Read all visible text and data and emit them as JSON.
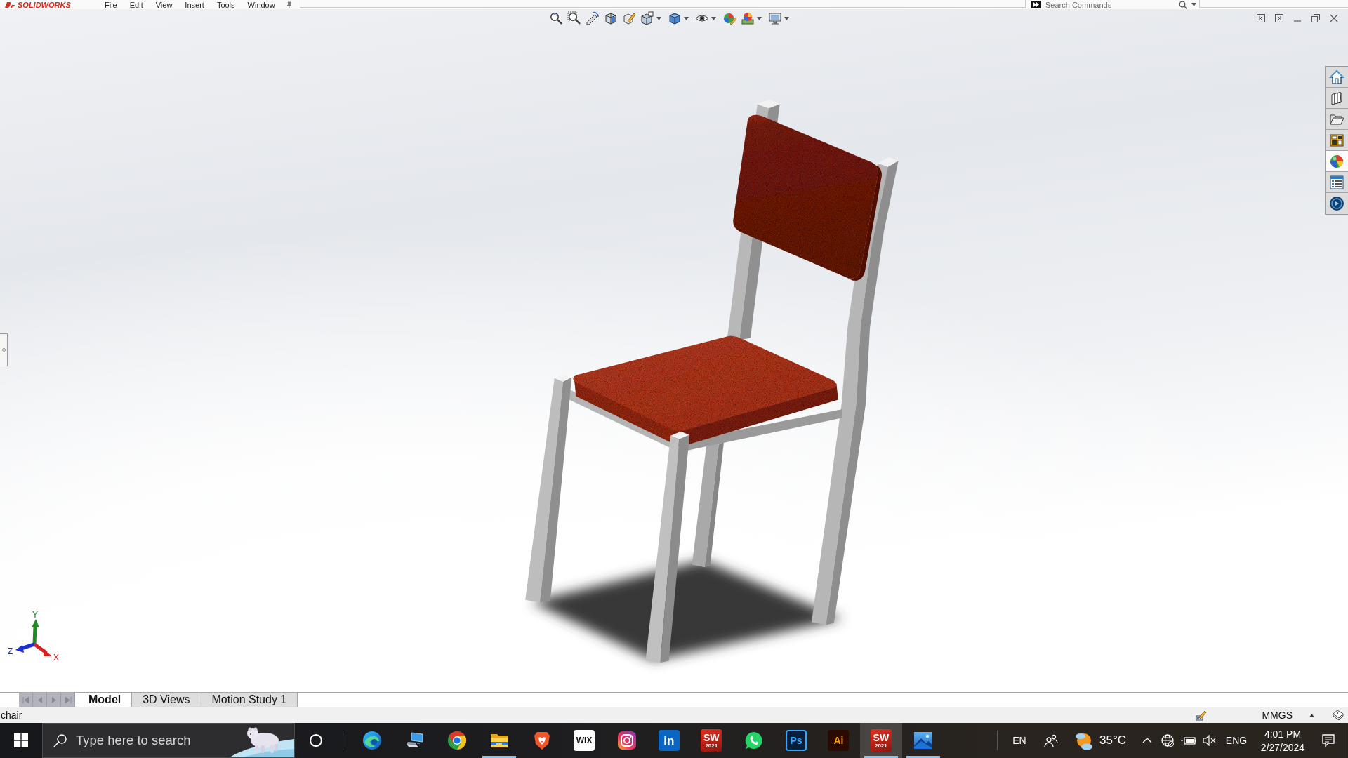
{
  "app": {
    "logo": "SOLIDWORKS",
    "menu": [
      "File",
      "Edit",
      "View",
      "Insert",
      "Tools",
      "Window"
    ],
    "search": {
      "placeholder": "Search Commands"
    }
  },
  "task_pane": {
    "tabs": [
      {
        "kind": "home",
        "selected": false
      },
      {
        "kind": "library",
        "selected": false
      },
      {
        "kind": "folder",
        "selected": false
      },
      {
        "kind": "palette",
        "selected": false
      },
      {
        "kind": "appearance",
        "selected": true
      },
      {
        "kind": "properties",
        "selected": false
      },
      {
        "kind": "forum",
        "selected": false
      }
    ]
  },
  "triad": {
    "axes": [
      {
        "label": "Y",
        "color": "#1e8c1e"
      },
      {
        "label": "Z",
        "color": "#1c2fd6"
      },
      {
        "label": "X",
        "color": "#d42020"
      }
    ]
  },
  "document_tabs": [
    {
      "label": "Model",
      "selected": true
    },
    {
      "label": "3D Views",
      "selected": false
    },
    {
      "label": "Motion Study 1",
      "selected": false
    }
  ],
  "status_bar": {
    "document": "chair",
    "units": "MMGS"
  },
  "taskbar": {
    "search": {
      "placeholder": "Type here to search"
    },
    "apps": [
      {
        "kind": "edge",
        "open": false,
        "selected": false
      },
      {
        "kind": "computer",
        "open": false,
        "selected": false
      },
      {
        "kind": "chrome",
        "open": false,
        "selected": false
      },
      {
        "kind": "explorer",
        "open": true,
        "selected": false
      },
      {
        "kind": "brave",
        "open": false,
        "selected": false
      },
      {
        "kind": "wix",
        "label": "WIX",
        "open": false,
        "selected": false
      },
      {
        "kind": "instagram",
        "open": false,
        "selected": false
      },
      {
        "kind": "linkedin",
        "label": "in",
        "open": false,
        "selected": false
      },
      {
        "kind": "solidworks",
        "label": "SW",
        "sublabel": "2021",
        "open": false,
        "selected": false
      },
      {
        "kind": "whatsapp",
        "open": false,
        "selected": false
      },
      {
        "kind": "photoshop",
        "label": "Ps",
        "open": false,
        "selected": false
      },
      {
        "kind": "illustrator",
        "label": "Ai",
        "open": false,
        "selected": false
      },
      {
        "kind": "solidworks",
        "label": "SW",
        "sublabel": "2021",
        "open": true,
        "selected": true
      },
      {
        "kind": "photos",
        "open": true,
        "selected": false
      }
    ],
    "language": "EN",
    "weather": {
      "temperature": "35°C"
    },
    "input_language": "ENG",
    "time": "4:01 PM",
    "date": "2/27/2024"
  }
}
